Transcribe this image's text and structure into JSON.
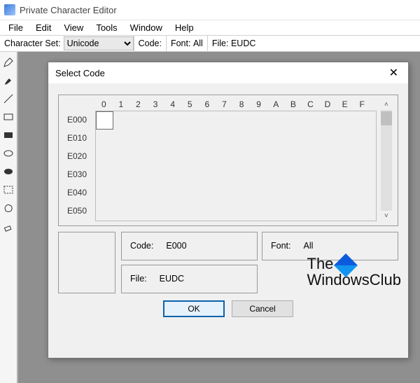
{
  "app": {
    "title": "Private Character Editor"
  },
  "menu": [
    "File",
    "Edit",
    "View",
    "Tools",
    "Window",
    "Help"
  ],
  "infobar": {
    "charset_label": "Character Set:",
    "charset_value": "Unicode",
    "code_label": "Code:",
    "font_label": "Font:",
    "font_value": "All",
    "file_label": "File:",
    "file_value": "EUDC"
  },
  "dialog": {
    "title": "Select Code",
    "columns": [
      "0",
      "1",
      "2",
      "3",
      "4",
      "5",
      "6",
      "7",
      "8",
      "9",
      "A",
      "B",
      "C",
      "D",
      "E",
      "F"
    ],
    "rows": [
      "E000",
      "E010",
      "E020",
      "E030",
      "E040",
      "E050"
    ],
    "code_label": "Code:",
    "code_value": "E000",
    "font_label": "Font:",
    "font_value": "All",
    "file_label": "File:",
    "file_value": "EUDC",
    "ok": "OK",
    "cancel": "Cancel"
  },
  "watermark": {
    "line1": "The",
    "line2": "WindowsClub"
  }
}
